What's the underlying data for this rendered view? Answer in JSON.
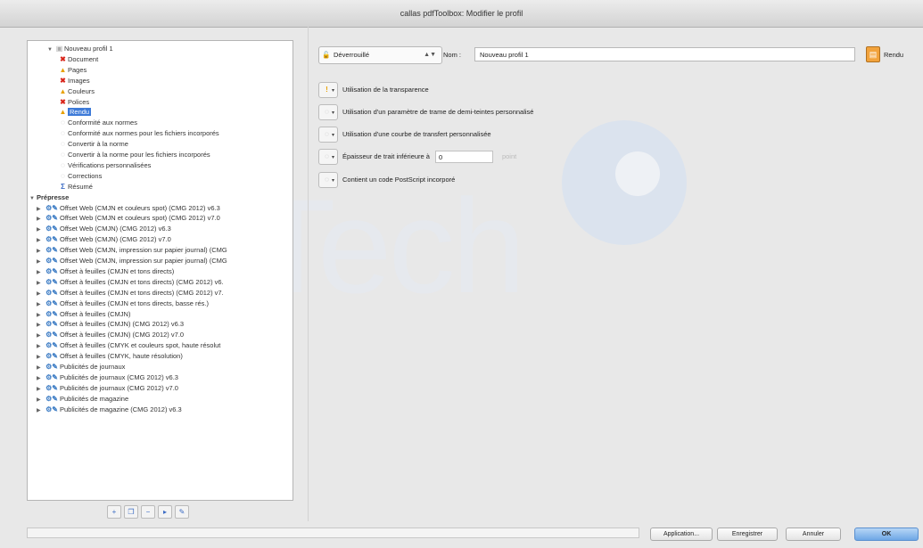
{
  "window": {
    "title": "callas pdfToolbox: Modifier le profil"
  },
  "tree": {
    "root_label": "Nouveau profil 1",
    "checks": [
      {
        "label": "Document",
        "status": "error"
      },
      {
        "label": "Pages",
        "status": "warning"
      },
      {
        "label": "Images",
        "status": "error"
      },
      {
        "label": "Couleurs",
        "status": "warning"
      },
      {
        "label": "Polices",
        "status": "error"
      },
      {
        "label": "Rendu",
        "status": "warning",
        "selected": true
      }
    ],
    "conformity": [
      "Conformité aux normes",
      "Conformité aux normes pour les fichiers incorporés",
      "Convertir à la norme",
      "Convertir à la norme pour les fichiers incorporés",
      "Vérifications personnalisées",
      "Corrections"
    ],
    "summary_label": "Résumé",
    "group_label": "Prépresse",
    "profiles": [
      "Offset Web (CMJN et couleurs spot) (CMG 2012) v6.3",
      "Offset Web (CMJN et couleurs spot) (CMG 2012) v7.0",
      "Offset Web (CMJN) (CMG 2012) v6.3",
      "Offset Web (CMJN) (CMG 2012) v7.0",
      "Offset Web (CMJN, impression sur papier journal) (CMG",
      "Offset Web (CMJN, impression sur papier journal) (CMG",
      "Offset à feuilles (CMJN et tons directs)",
      "Offset à feuilles (CMJN et tons directs) (CMG 2012) v6.",
      "Offset à feuilles (CMJN et tons directs) (CMG 2012) v7.",
      "Offset à feuilles (CMJN et tons directs, basse rés.)",
      "Offset à feuilles (CMJN)",
      "Offset à feuilles (CMJN) (CMG 2012) v6.3",
      "Offset à feuilles (CMJN) (CMG 2012) v7.0",
      "Offset à feuilles (CMYK et couleurs spot, haute résolut",
      "Offset à feuilles (CMYK, haute résolution)",
      "Publicités de journaux",
      "Publicités de journaux (CMG 2012) v6.3",
      "Publicités de journaux (CMG 2012) v7.0",
      "Publicités de magazine",
      "Publicités de magazine (CMG 2012) v6.3"
    ]
  },
  "form": {
    "lock_state": "Déverrouillé",
    "name_label": "Nom :",
    "name_value": "Nouveau profil 1",
    "rendu_label": "Rendu",
    "rows": [
      {
        "label": "Utilisation de la transparence",
        "severity": "warning"
      },
      {
        "label": "Utilisation d'un paramètre de trame de demi-teintes personnalisé",
        "severity": "off"
      },
      {
        "label": "Utilisation d'une courbe de transfert personnalisée",
        "severity": "off"
      },
      {
        "label": "Épaisseur de trait inférieure à",
        "severity": "off",
        "value": "0",
        "unit": "point"
      },
      {
        "label": "Contient un code PostScript incorporé",
        "severity": "off"
      }
    ]
  },
  "buttons": {
    "apply": "Application...",
    "save": "Enregistrer",
    "cancel": "Annuler",
    "ok": "OK"
  },
  "watermark": {
    "text": "Tech"
  }
}
